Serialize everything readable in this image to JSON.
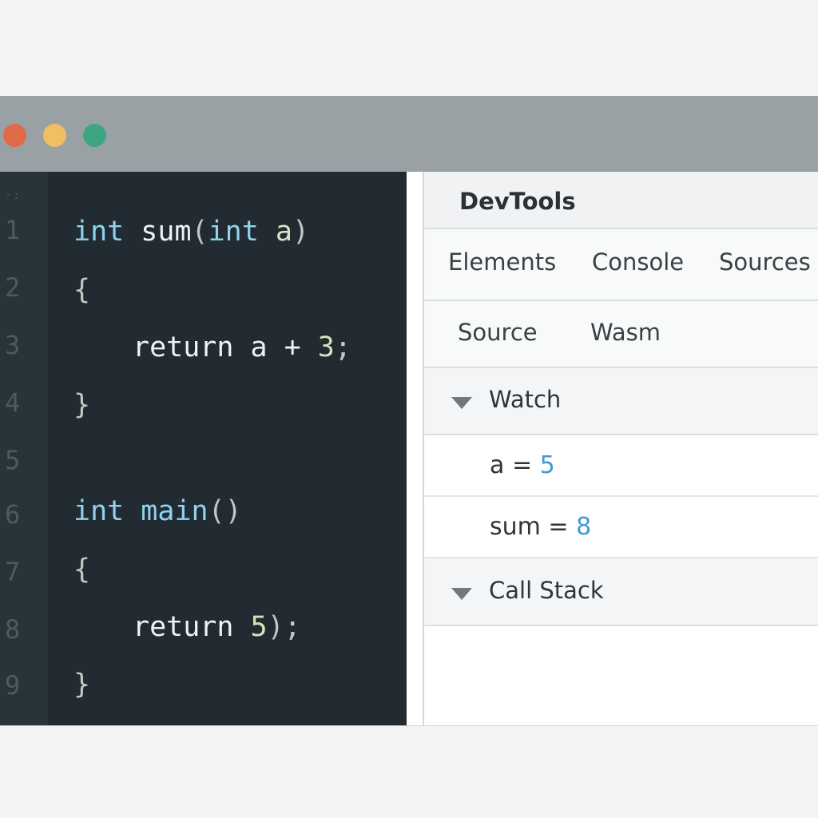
{
  "window": {
    "traffic_lights": {
      "close_color": "#e06a45",
      "minimize_color": "#f0bf62",
      "maximize_color": "#3ea583"
    }
  },
  "editor": {
    "gutter_mark": "·:",
    "line_numbers": [
      "1",
      "2",
      "3",
      "4",
      "5",
      "6",
      "7",
      "8",
      "9"
    ],
    "lines": [
      [
        {
          "t": "int",
          "c": "kw"
        },
        {
          "t": " ",
          "c": "fn"
        },
        {
          "t": "sum",
          "c": "fn"
        },
        {
          "t": "(",
          "c": "punc"
        },
        {
          "t": "int",
          "c": "kw"
        },
        {
          "t": " ",
          "c": "fn"
        },
        {
          "t": "a",
          "c": "var"
        },
        {
          "t": ")",
          "c": "punc"
        }
      ],
      [
        {
          "t": "{",
          "c": "punc"
        }
      ],
      [
        {
          "t": "return",
          "c": "fn"
        },
        {
          "t": " a + ",
          "c": "fn"
        },
        {
          "t": "3",
          "c": "num"
        },
        {
          "t": ";",
          "c": "punc"
        }
      ],
      [
        {
          "t": "}",
          "c": "punc"
        }
      ],
      [],
      [
        {
          "t": "int",
          "c": "kw"
        },
        {
          "t": " ",
          "c": "fn"
        },
        {
          "t": "main",
          "c": "kw"
        },
        {
          "t": "()",
          "c": "punc"
        }
      ],
      [
        {
          "t": "{",
          "c": "punc"
        }
      ],
      [
        {
          "t": "return",
          "c": "fn"
        },
        {
          "t": " ",
          "c": "fn"
        },
        {
          "t": "5",
          "c": "num"
        },
        {
          "t": ");",
          "c": "punc"
        }
      ],
      [
        {
          "t": "}",
          "c": "punc"
        }
      ]
    ],
    "colors": {
      "background": "#222b32",
      "keyword": "#8fd3ef",
      "number": "#d3e3b8"
    }
  },
  "devtools": {
    "title": "DevTools",
    "tabs": [
      "Elements",
      "Console",
      "Sources"
    ],
    "subtabs": [
      "Source",
      "Wasm"
    ],
    "watch": {
      "label": "Watch",
      "expanded": true,
      "items": [
        {
          "name": "a",
          "op": "=",
          "value": "5"
        },
        {
          "name": "sum",
          "op": "=",
          "value": "8"
        }
      ]
    },
    "call_stack": {
      "label": "Call Stack",
      "expanded": true
    },
    "colors": {
      "value": "#3f9bd6"
    }
  }
}
